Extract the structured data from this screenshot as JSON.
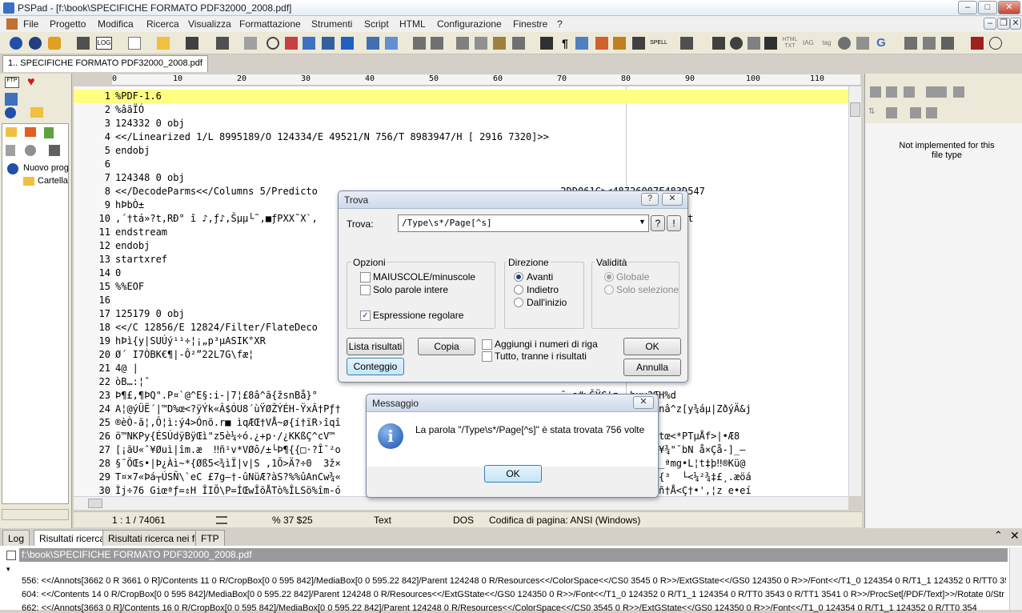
{
  "window": {
    "title": "PSPad - [f:\\book\\SPECIFICHE FORMATO PDF32000_2008.pdf]"
  },
  "menu": [
    "File",
    "Progetto",
    "Modifica",
    "Ricerca",
    "Visualizza",
    "Formattazione",
    "Strumenti",
    "Script",
    "HTML",
    "Configurazione",
    "Finestre",
    "?"
  ],
  "file_tab": "1.. SPECIFICHE FORMATO PDF32000_2008.pdf",
  "left_panel": {
    "tree_root": "Nuovo prog",
    "tree_child": "Cartella"
  },
  "ruler": [
    "0",
    "10",
    "20",
    "30",
    "40",
    "50",
    "60",
    "70",
    "80",
    "90",
    "100",
    "110"
  ],
  "editor_lines": [
    {
      "n": "1",
      "t": "%PDF-1.6"
    },
    {
      "n": "2",
      "t": "%âãÏÓ"
    },
    {
      "n": "3",
      "t": "124332 0 obj"
    },
    {
      "n": "4",
      "t": "<</Linearized 1/L 8995189/O 124334/E 49521/N 756/T 8983947/H [ 2916 7320]>>"
    },
    {
      "n": "5",
      "t": "endobj"
    },
    {
      "n": "6",
      "t": ""
    },
    {
      "n": "7",
      "t": "124348 0 obj"
    },
    {
      "n": "8",
      "t": "<</DecodeParms<</Columns 5/Predicto                                          2DD061C><48726007F483D547"
    },
    {
      "n": "9",
      "t": "hÞbÒ±"
    },
    {
      "n": "10",
      "t": ",´†tá»?t,RÐ° î ♪,ƒ♪,Šµµ└˜,■ƒPXX˜X`,                                         ý¹ýÉlú¾ƒø«~æ¾HWHWW^t…t…t"
    },
    {
      "n": "11",
      "t": "endstream"
    },
    {
      "n": "12",
      "t": "endobj"
    },
    {
      "n": "13",
      "t": "startxref"
    },
    {
      "n": "14",
      "t": "0"
    },
    {
      "n": "15",
      "t": "%%EOF"
    },
    {
      "n": "16",
      "t": ""
    },
    {
      "n": "17",
      "t": "125179 0 obj"
    },
    {
      "n": "18",
      "t": "<</C 12856/E 12824/Filter/FlateDeco"
    },
    {
      "n": "19",
      "t": "hÞì{y|SUÚý¹¹÷¦¡„p³µASIK°XR"
    },
    {
      "n": "20",
      "t": "Ø´ I7ÒBK€¶|-Ô²”22L7G\\fæ¦"
    },
    {
      "n": "21",
      "t": "4@ |"
    },
    {
      "n": "22",
      "t": "òB…:¦ˆ"
    },
    {
      "n": "23",
      "t": "Þ¶£,¶ÞQ\".P¤`@^E§:i-|7¦£8â^ã{žsnBå}°                                          ¯»e#>ŠŸÇ'z… huv?ŒH%d"
    },
    {
      "n": "24",
      "t": "A¦@ýÜË´|™D%œ<?ÿÝk«Â$ÓU8´ùŸØŽÝÉH-ŸxÂ†Pƒ†                                         õŸ^d*ÜDiÿYe|ú|nâ^z[y¾áµ|ZðýÄ&j"
    },
    {
      "n": "25",
      "t": "®èÒ-ã¦,Ô¦ì:ý4>Ónõ.r■ ìqÆŒ†VÅ~ø{í†ïR›îqî"
    },
    {
      "n": "26",
      "t": "ö™NKPy{ÉSÚdÿBÿŒì\"z5è¼÷ó.¿+p·/¿KKßÇ^cV™                                           v %µjÿ/?‼õ¶gútœ<*PTµÅf>|•Æ8"
    },
    {
      "n": "27",
      "t": "[¡ãU«ˆ¥Øuì|îm.æ  ‼ñ¹v*VØô/±└Þ¶{{□·?Î¯²o                                          ¯³¶|\\U¯åç1³ƒñ¥¾\"¯bN å×Çå-]_—"
    },
    {
      "n": "28",
      "t": "§¯ÕŒs•|Þ¿Àì~*{Øß5<¾ìÏ|v|S ,1Õ>Ä?÷0  3ž×                                           ═kÉŒ:õñ~Èu0˜_ªmg•L¦t‡þ‼®Kü@"
    },
    {
      "n": "29",
      "t": "T¤×7«Þá┬ÚSÑ\\`eC £7g—†-ûNüÆ?àS?%%ûAnCw¾«                                         ═1´xXû ÷ç ‹r«\"{³  └<¼²¾‡£¸.æöá"
    },
    {
      "n": "30",
      "t": "Ìj÷76 Giœªƒ=⇕H ÎIÕ\\P=ÍŒwÎõÅTò%ÎLSö%îm-ó                                         rþA[Ä©Ð7Í‹mj3§ñ†Å<Ç†•',¦z e•eí"
    }
  ],
  "status": {
    "position": "1 : 1 / 74061",
    "char": "%  37  $25",
    "mode": "Text",
    "eol": "DOS",
    "codepage": "Codifica di pagina: ANSI (Windows)"
  },
  "right_panel": {
    "message": "Not implemented for this file type"
  },
  "log_tabs": [
    "Log",
    "Risultati ricerca",
    "Risultati ricerca nei file",
    "FTP"
  ],
  "log": {
    "header": "f:\\book\\SPECIFICHE FORMATO PDF32000_2008.pdf",
    "lines": [
      "556: <</Annots[3662 0 R 3661 0 R]/Contents 11 0 R/CropBox[0 0 595 842]/MediaBox[0 0 595.22 842]/Parent 124248 0 R/Resources<</ColorSpace<</CS0 3545 0 R>>/ExtGState<</GS0 124350 0 R>>/Font<</T1_0 124354 0 R/T1_1 124352 0 R/TT0 354",
      "604: <</Contents 14 0 R/CropBox[0 0 595 842]/MediaBox[0 0 595.22 842]/Parent 124248 0 R/Resources<</ExtGState<</GS0 124350 0 R>>/Font<</T1_0 124352 0 R/T1_1 124354 0 R/TT0 3543 0 R/TT1 3541 0 R>>/ProcSet[/PDF/Text]>>/Rotate 0/Str",
      "662: <</Annots[3663 0 R]/Contents 16 0 R/CropBox[0 0 595 842]/MediaBox[0 0 595.22 842]/Parent 124248 0 R/Resources<</ColorSpace<</CS0 3545 0 R>>/ExtGState<</GS0 124350 0 R>>/Font<</T1_0 124354 0 R/T1_1 124352 0 R/TT0 354"
    ]
  },
  "find_dialog": {
    "title": "Trova",
    "find_label": "Trova:",
    "find_value": "/Type\\s*/Page[^s]",
    "help_btn": "?",
    "excl_btn": "!",
    "options": {
      "label": "Opzioni",
      "case": "MAIUSCOLE/minuscole",
      "whole": "Solo parole intere",
      "regex": "Espressione regolare"
    },
    "direction": {
      "label": "Direzione",
      "forward": "Avanti",
      "backward": "Indietro",
      "from_start": "Dall'inizio"
    },
    "validity": {
      "label": "Validità",
      "global": "Globale",
      "selection": "Solo selezione"
    },
    "buttons": {
      "list": "Lista risultati",
      "copy": "Copia",
      "count": "Conteggio",
      "ok": "OK",
      "cancel": "Annulla"
    },
    "add_line_numbers": "Aggiungi i numeri di riga",
    "all_except": "Tutto, tranne i risultati"
  },
  "message_dialog": {
    "title": "Messaggio",
    "text": "La parola \"/Type\\s*/Page[^s]\" è stata trovata 756 volte",
    "ok": "OK"
  }
}
